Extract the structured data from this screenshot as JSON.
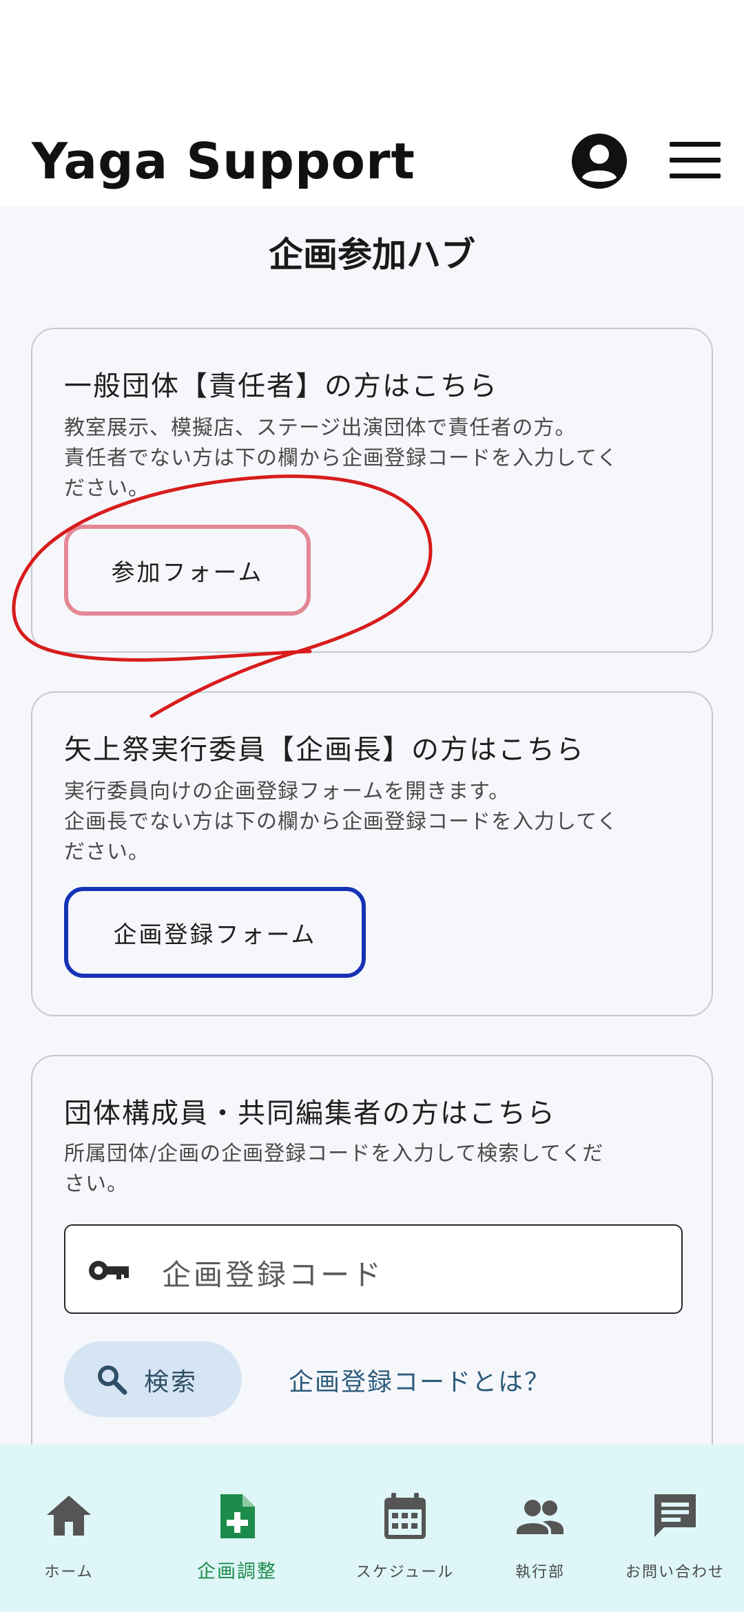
{
  "app": {
    "brand": "Yaga Support",
    "avatar_icon": "account-circle-icon",
    "menu_icon": "hamburger-menu-icon"
  },
  "page": {
    "title": "企画参加ハブ"
  },
  "cards": {
    "general": {
      "title": "一般団体【責任者】の方はこちら",
      "desc_line1": "教室展示、模擬店、ステージ出演団体で責任者の方。",
      "desc_line2": "責任者でない方は下の欄から企画登録コードを入力してく",
      "desc_line3": "ださい。",
      "button": "参加フォーム"
    },
    "committee": {
      "title": "矢上祭実行委員【企画長】の方はこちら",
      "desc_line1": "実行委員向けの企画登録フォームを開きます。",
      "desc_line2": "企画長でない方は下の欄から企画登録コードを入力してく",
      "desc_line3": "ださい。",
      "button": "企画登録フォーム"
    },
    "members": {
      "title": "団体構成員・共同編集者の方はこちら",
      "desc_line1": "所属団体/企画の企画登録コードを入力して検索してくだ",
      "desc_line2": "さい。",
      "input_placeholder": "企画登録コード",
      "search_button": "検索",
      "code_link": "企画登録コードとは？"
    }
  },
  "bottom_nav": {
    "items": [
      {
        "label": "ホーム",
        "icon": "home-icon"
      },
      {
        "label": "企画調整",
        "icon": "add-document-icon",
        "active": true
      },
      {
        "label": "スケジュール",
        "icon": "calendar-icon"
      },
      {
        "label": "執行部",
        "icon": "people-icon"
      },
      {
        "label": "お問い合わせ",
        "icon": "chat-icon"
      }
    ]
  },
  "colors": {
    "active_nav": "#1d8b4a",
    "pink_button_border": "#e38794",
    "blue_button_border": "#1633b6",
    "search_button_bg": "#d6e5f3",
    "nav_bg": "#def6f7",
    "annotation_red": "#d81c1c"
  }
}
